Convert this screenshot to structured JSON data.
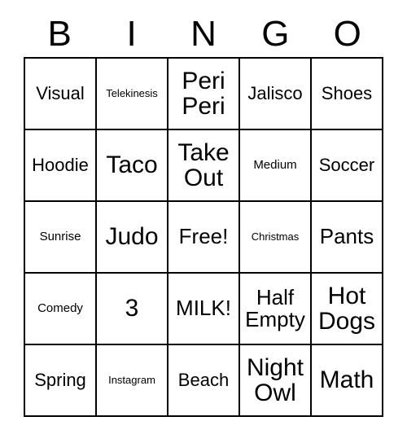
{
  "card": {
    "headers": [
      "B",
      "I",
      "N",
      "G",
      "O"
    ],
    "rows": [
      [
        {
          "text": "Visual",
          "size": "fs-md"
        },
        {
          "text": "Telekinesis",
          "size": "fs-xs"
        },
        {
          "text": "Peri Peri",
          "size": "fs-xl"
        },
        {
          "text": "Jalisco",
          "size": "fs-md"
        },
        {
          "text": "Shoes",
          "size": "fs-md"
        }
      ],
      [
        {
          "text": "Hoodie",
          "size": "fs-md"
        },
        {
          "text": "Taco",
          "size": "fs-xl"
        },
        {
          "text": "Take Out",
          "size": "fs-xl"
        },
        {
          "text": "Medium",
          "size": "fs-sm"
        },
        {
          "text": "Soccer",
          "size": "fs-md"
        }
      ],
      [
        {
          "text": "Sunrise",
          "size": "fs-sm"
        },
        {
          "text": "Judo",
          "size": "fs-xl"
        },
        {
          "text": "Free!",
          "size": "fs-lg"
        },
        {
          "text": "Christmas",
          "size": "fs-xs"
        },
        {
          "text": "Pants",
          "size": "fs-lg"
        }
      ],
      [
        {
          "text": "Comedy",
          "size": "fs-sm"
        },
        {
          "text": "3",
          "size": "fs-xl"
        },
        {
          "text": "MILK!",
          "size": "fs-lg"
        },
        {
          "text": "Half Empty",
          "size": "fs-lg"
        },
        {
          "text": "Hot Dogs",
          "size": "fs-xl"
        }
      ],
      [
        {
          "text": "Spring",
          "size": "fs-md"
        },
        {
          "text": "Instagram",
          "size": "fs-xs"
        },
        {
          "text": "Beach",
          "size": "fs-md"
        },
        {
          "text": "Night Owl",
          "size": "fs-xl"
        },
        {
          "text": "Math",
          "size": "fs-xl"
        }
      ]
    ]
  },
  "colors": {
    "border": "#000000",
    "background": "#ffffff",
    "text": "#000000"
  }
}
